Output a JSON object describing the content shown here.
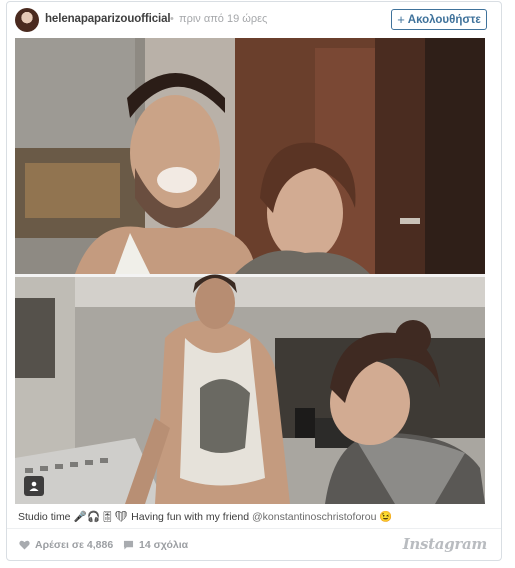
{
  "post": {
    "username": "helenapaparizouofficial",
    "separator": "•",
    "time": "πριν από 19 ώρες",
    "follow_label": "Ακολουθήστε",
    "follow_icon": "plus-icon"
  },
  "caption": {
    "prefix": "Studio time",
    "emoji": "🎤🎧🎚❤",
    "middle": " Having fun with my friend ",
    "mention": "@konstantinoschristoforou",
    "suffix": " 😉"
  },
  "footer": {
    "likes": "Αρέσει σε 4,886",
    "comments": "14 σχόλια",
    "logo": "Instagram"
  },
  "colors": {
    "accent": "#3f729b",
    "muted": "#9b9ea2",
    "border": "#d9dee3"
  }
}
